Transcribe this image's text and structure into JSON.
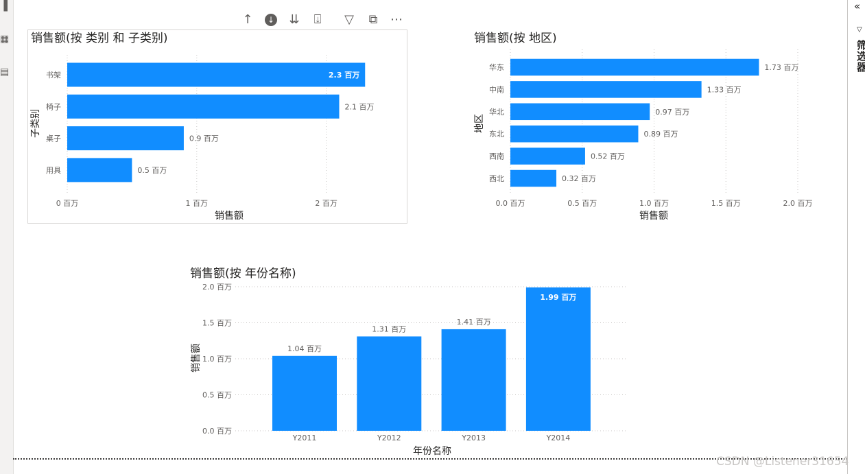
{
  "app": {
    "left_rail_icons": [
      "report-view-icon",
      "data-view-icon",
      "model-view-icon"
    ],
    "filters_pane": {
      "title": "筛选器",
      "collapse_icon": "double-chevron-left-icon",
      "filter_icon": "filter-icon"
    }
  },
  "visual_header": {
    "buttons": [
      {
        "name": "drill-up-button",
        "icon": "arrow-up-icon",
        "glyph": "↑"
      },
      {
        "name": "drill-down-toggle-button",
        "icon": "arrow-down-circle-icon",
        "glyph": "↓"
      },
      {
        "name": "next-level-button",
        "icon": "double-arrow-down-icon",
        "glyph": "⇊"
      },
      {
        "name": "expand-next-level-button",
        "icon": "fork-down-icon",
        "glyph": "⍗"
      },
      {
        "name": "filter-visual-button",
        "icon": "filter-icon",
        "glyph": "▽"
      },
      {
        "name": "focus-mode-button",
        "icon": "focus-mode-icon",
        "glyph": "⧉"
      },
      {
        "name": "more-options-button",
        "icon": "ellipsis-icon",
        "glyph": "⋯"
      }
    ]
  },
  "watermark": "CSDN @Listener31654",
  "colors": {
    "bar": "#118dff",
    "text": "#252423",
    "muted": "#605e5c"
  },
  "chart_data": [
    {
      "type": "bar",
      "orientation": "horizontal",
      "title": "销售额(按 类别 和 子类别)",
      "xlabel": "销售额",
      "ylabel": "子类别",
      "categories": [
        "书架",
        "椅子",
        "桌子",
        "用具"
      ],
      "values": [
        2.3,
        2.1,
        0.9,
        0.5
      ],
      "value_labels": [
        "2.3 百万",
        "2.1 百万",
        "0.9 百万",
        "0.5 百万"
      ],
      "xlim": [
        0,
        2.5
      ],
      "xticks": [
        0,
        1,
        2
      ],
      "xtick_labels": [
        "0 百万",
        "1 百万",
        "2 百万"
      ],
      "grid": true
    },
    {
      "type": "bar",
      "orientation": "horizontal",
      "title": "销售额(按 地区)",
      "xlabel": "销售额",
      "ylabel": "地区",
      "categories": [
        "华东",
        "中南",
        "华北",
        "东北",
        "西南",
        "西北"
      ],
      "values": [
        1.73,
        1.33,
        0.97,
        0.89,
        0.52,
        0.32
      ],
      "value_labels": [
        "1.73 百万",
        "1.33 百万",
        "0.97 百万",
        "0.89 百万",
        "0.52 百万",
        "0.32 百万"
      ],
      "xlim": [
        0,
        2.0
      ],
      "xticks": [
        0,
        0.5,
        1.0,
        1.5,
        2.0
      ],
      "xtick_labels": [
        "0.0 百万",
        "0.5 百万",
        "1.0 百万",
        "1.5 百万",
        "2.0 百万"
      ],
      "grid": true
    },
    {
      "type": "bar",
      "orientation": "vertical",
      "title": "销售额(按 年份名称)",
      "xlabel": "年份名称",
      "ylabel": "销售额",
      "categories": [
        "Y2011",
        "Y2012",
        "Y2013",
        "Y2014"
      ],
      "values": [
        1.04,
        1.31,
        1.41,
        1.99
      ],
      "value_labels": [
        "1.04 百万",
        "1.31 百万",
        "1.41 百万",
        "1.99 百万"
      ],
      "ylim": [
        0,
        2.0
      ],
      "yticks": [
        0,
        0.5,
        1.0,
        1.5,
        2.0
      ],
      "ytick_labels": [
        "0.0 百万",
        "0.5 百万",
        "1.0 百万",
        "1.5 百万",
        "2.0 百万"
      ],
      "grid": true
    }
  ]
}
